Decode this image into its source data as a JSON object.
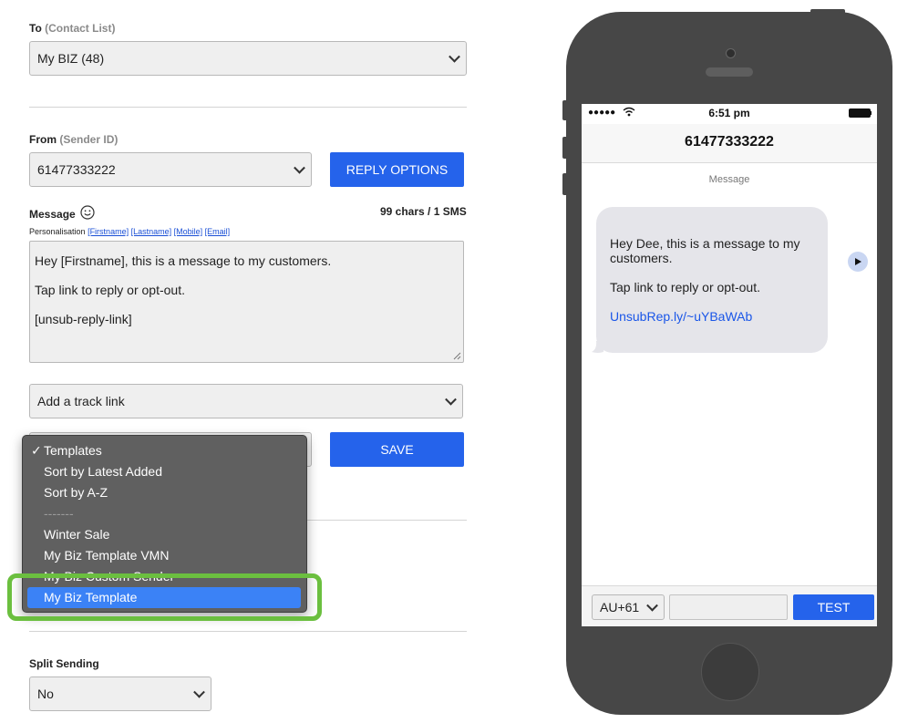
{
  "to": {
    "label": "To",
    "sub": "(Contact List)",
    "value": "My BIZ (48)"
  },
  "from": {
    "label": "From",
    "sub": "(Sender ID)",
    "value": "61477333222",
    "reply_options": "REPLY OPTIONS"
  },
  "message": {
    "label": "Message",
    "counter": "99 chars / 1 SMS",
    "personalisation_label": "Personalisation",
    "tags": [
      "[Firstname]",
      "[Lastname]",
      "[Mobile]",
      "[Email]"
    ],
    "lines": [
      "Hey [Firstname], this is a message to my customers.",
      "Tap link to reply or opt-out.",
      "[unsub-reply-link]"
    ]
  },
  "track_link": {
    "value": "Add a track link"
  },
  "save_label": "SAVE",
  "templates_dropdown": {
    "items": [
      {
        "label": "Templates",
        "checked": true
      },
      {
        "label": "Sort by Latest Added"
      },
      {
        "label": "Sort by A-Z"
      },
      {
        "label": "-------"
      },
      {
        "label": "Winter Sale"
      },
      {
        "label": "My Biz Template VMN"
      },
      {
        "label": "My Biz Custom Sender"
      },
      {
        "label": "My Biz Template",
        "selected": true
      }
    ]
  },
  "split_sending": {
    "label": "Split Sending",
    "value": "No"
  },
  "phone": {
    "time": "6:51 pm",
    "contact": "61477333222",
    "section_label": "Message",
    "bubble": {
      "line1": "Hey Dee, this is a message to my customers.",
      "line2": "Tap link to reply or opt-out.",
      "link": "UnsubRep.ly/~uYBaWAb"
    },
    "country_code": "AU+61",
    "test_number_placeholder": "",
    "test_label": "TEST"
  },
  "colors": {
    "accent": "#2563eb",
    "highlight": "#6bbf3f",
    "dropdown_bg": "#606060",
    "phone_body": "#474747"
  }
}
